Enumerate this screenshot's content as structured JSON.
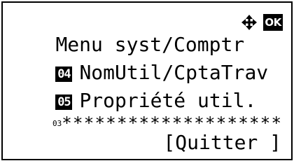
{
  "header": {
    "title": "Menu syst/Comptr",
    "nav_icon": "four-way-arrow-icon",
    "ok_label": "OK"
  },
  "menu": {
    "items": [
      {
        "number": "04",
        "label": "NomUtil/CptaTrav"
      },
      {
        "number": "05",
        "label": "Propriété util."
      }
    ],
    "partial_number": "03",
    "stars": "********************"
  },
  "footer": {
    "quit_label": "[Quitter ]"
  }
}
